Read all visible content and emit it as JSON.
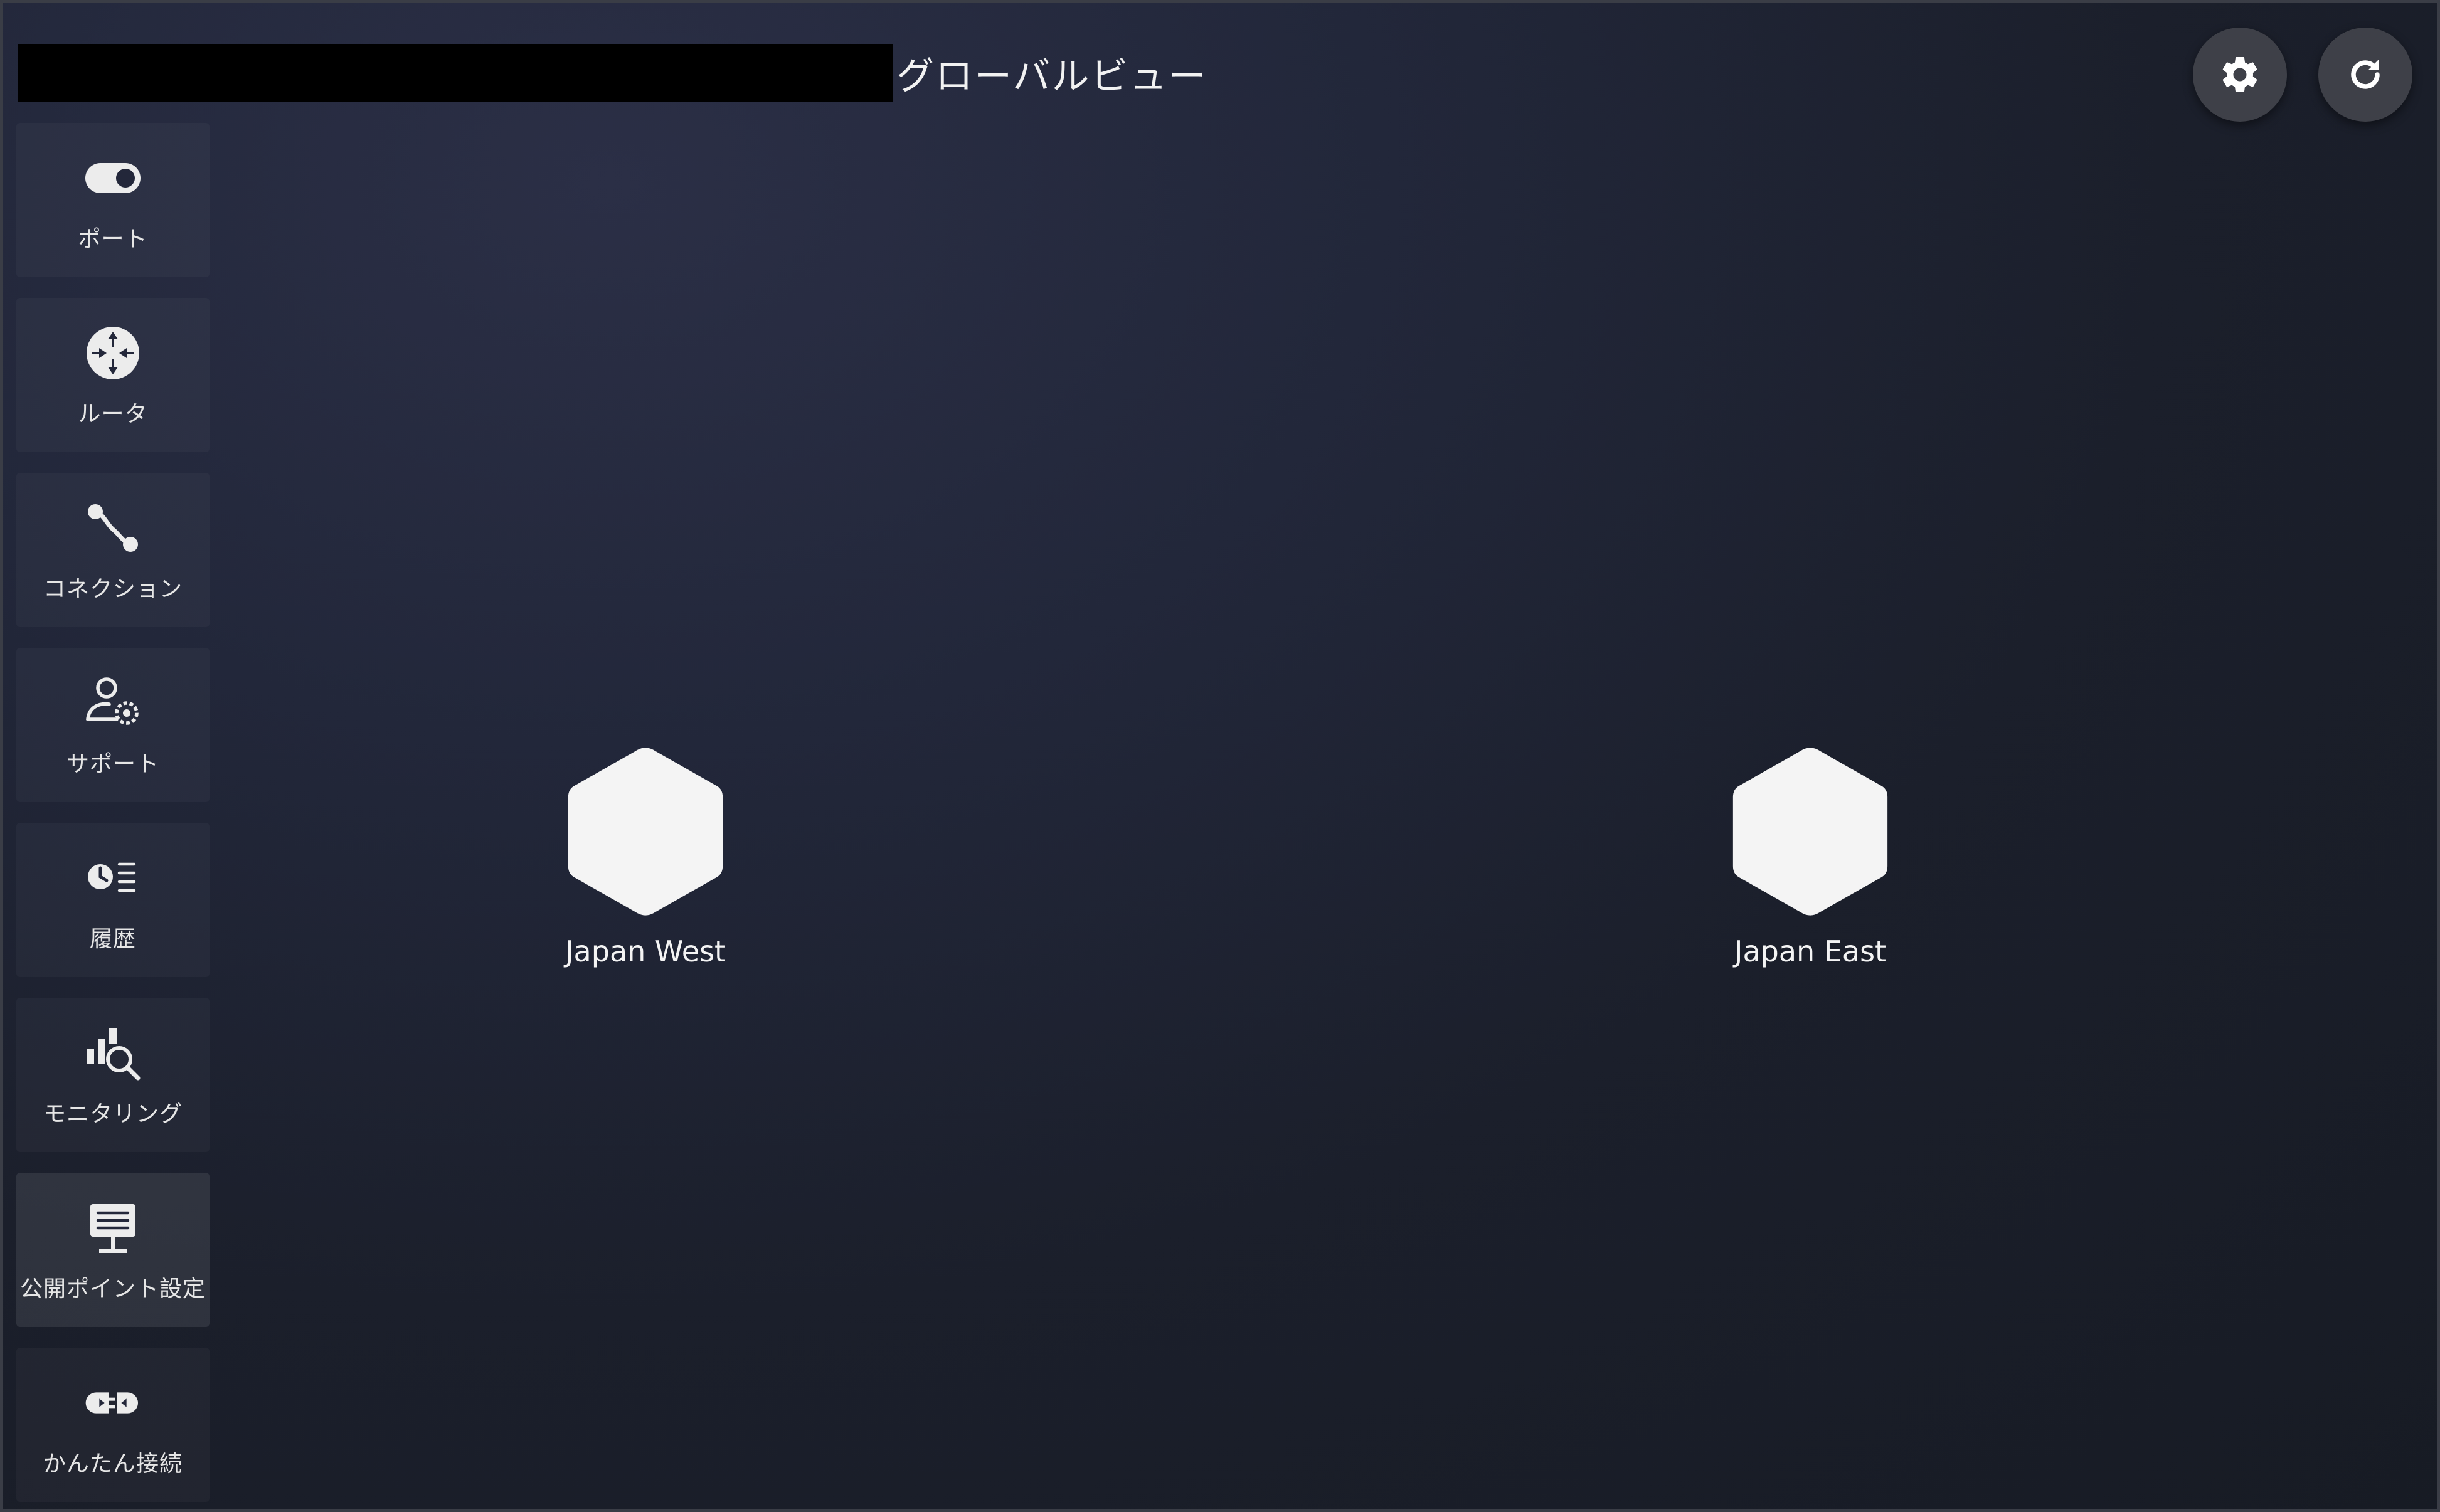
{
  "header": {
    "title": "グローバルビュー",
    "redacted_label": ""
  },
  "toolbar": {
    "settings_icon": "gear-icon",
    "refresh_icon": "refresh-icon"
  },
  "sidebar": {
    "items": [
      {
        "label": "ポート",
        "icon": "port-toggle-icon"
      },
      {
        "label": "ルータ",
        "icon": "router-icon"
      },
      {
        "label": "コネクション",
        "icon": "connection-icon"
      },
      {
        "label": "サポート",
        "icon": "support-user-gear-icon"
      },
      {
        "label": "履歴",
        "icon": "history-clock-list-icon"
      },
      {
        "label": "モニタリング",
        "icon": "monitoring-chart-search-icon"
      },
      {
        "label": "公開ポイント設定",
        "icon": "public-point-monitor-icon",
        "active": true
      },
      {
        "label": "かんたん接続",
        "icon": "easy-connect-plug-icon"
      }
    ]
  },
  "map": {
    "nodes": [
      {
        "label": "Japan West",
        "icon": "hexagon-node-icon"
      },
      {
        "label": "Japan East",
        "icon": "hexagon-node-icon"
      }
    ]
  },
  "colors": {
    "background_dark": "#1b1f2b",
    "sidebar_item_bg": "#262a36",
    "button_bg": "#3e4048",
    "node_fill": "#f4f4f4",
    "text": "#e8e8e8"
  }
}
